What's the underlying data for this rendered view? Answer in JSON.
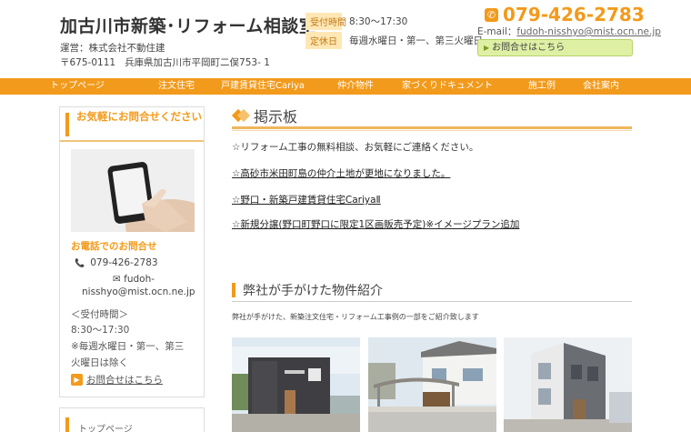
{
  "header": {
    "site_title": "加古川市新築･リフォーム相談室",
    "company": "運営：株式会社不動住建",
    "postal": "〒675-0111",
    "address": "兵庫県加古川市平岡町二俣753- 1",
    "hours_label": "受付時間",
    "hours": "8:30〜17:30",
    "closed_label": "定休日",
    "closed": "毎週水曜日・第一、第三火曜日",
    "phone": "079-426-2783",
    "email_prefix": "E-mail：",
    "email": "fudoh-nisshyo@mist.ocn.ne.jp",
    "contact_button": "お問合せはこちら"
  },
  "nav": {
    "items": [
      {
        "label": "トップページ"
      },
      {
        "label": "注文住宅"
      },
      {
        "label": "戸建賃貸住宅Cariya"
      },
      {
        "label": "仲介物件"
      },
      {
        "label": "家づくりドキュメント"
      },
      {
        "label": "施工例"
      },
      {
        "label": "会社案内"
      }
    ]
  },
  "sidebar": {
    "title": "お気軽にお問合せください",
    "phone_heading": "お電話でのお問合せ",
    "phone": "079-426-2783",
    "email_line1": "fudoh-",
    "email_line2": "nisshyo@mist.ocn.ne.jp",
    "hours_label": "＜受付時間＞",
    "hours": "8:30〜17:30",
    "closed_line1": "※毎週水曜日・第一、第三",
    "closed_line2": "火曜日は除く",
    "contact_link": "お問合せはこちら",
    "next_box_label": "トップページ"
  },
  "main": {
    "board_title": "掲示板",
    "news": [
      {
        "text": "☆リフォーム工事の無料相談、お気軽にご連絡ください。"
      },
      {
        "text": "☆高砂市米田町島の仲介土地が更地になりました。"
      },
      {
        "text": "☆野口・新築戸建賃貸住宅CariyaⅡ"
      },
      {
        "text": "☆新規分譲(野口町野口に限定1区画販売予定)※イメージプラン追加"
      }
    ],
    "works_title": "弊社が手がけた物件紹介",
    "works_desc": "弊社が手がけた、新築注文住宅・リフォーム工事例の一部をご紹介致します"
  },
  "colors": {
    "accent": "#f29a1b",
    "label_bg": "#ffe7b5",
    "button_bg": "#dff0a5"
  }
}
